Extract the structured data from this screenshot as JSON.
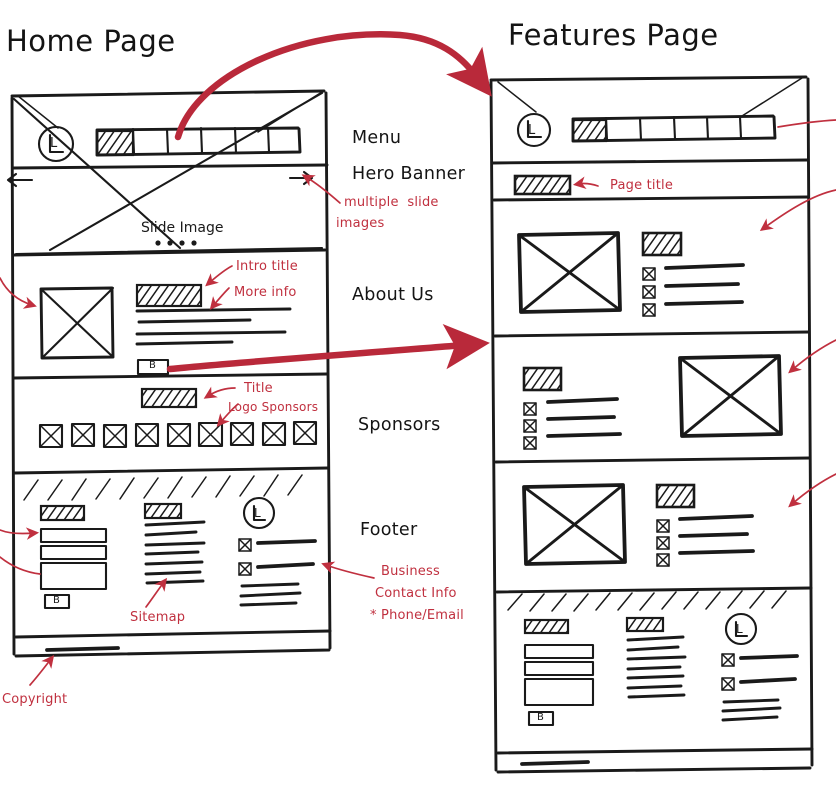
{
  "meta": {
    "kind": "hand-drawn website wireframe sketch",
    "ink_color": "#1a1a1a",
    "annotation_color": "#c0303f"
  },
  "pages": [
    {
      "id": "home",
      "title": "Home Page",
      "sections": [
        {
          "id": "header",
          "label": "Menu",
          "logo": "L",
          "menu_cells": 6,
          "active_cell_index": 0
        },
        {
          "id": "hero",
          "label": "Hero Banner",
          "placeholder_text": "Slide Image",
          "dots": 4,
          "prev_arrow": "←",
          "next_arrow": "→"
        },
        {
          "id": "about",
          "label": "About Us",
          "has_image": true,
          "heading_bar": true,
          "text_lines": 5,
          "button": "B"
        },
        {
          "id": "sponsors",
          "label": "Sponsors",
          "heading_bar": true,
          "logo_count": 9
        },
        {
          "id": "footer",
          "label": "Footer",
          "columns": 3,
          "column_1": {
            "heading_bar": true,
            "fields": 3,
            "button": "B"
          },
          "column_2": {
            "heading_bar": true,
            "link_lines": 7
          },
          "column_3": {
            "logo": "L",
            "contact_items": 2,
            "address_lines": 3
          }
        },
        {
          "id": "copyright",
          "label": "Copyright"
        }
      ],
      "annotations": [
        {
          "id": "multiple-slide-images",
          "text": "multiple slide\nimages"
        },
        {
          "id": "intro-title",
          "text": "Intro title"
        },
        {
          "id": "more-info",
          "text": "More info"
        },
        {
          "id": "sponsors-title",
          "text": "Title"
        },
        {
          "id": "logo-sponsors",
          "text": "Logo Sponsors"
        },
        {
          "id": "sitemap",
          "text": "Sitemap"
        },
        {
          "id": "business-contact",
          "text": "Business\nContact Info\n* Phone/Email"
        },
        {
          "id": "copyright",
          "text": "Copyright"
        }
      ]
    },
    {
      "id": "features",
      "title": "Features Page",
      "sections": [
        {
          "id": "header",
          "logo": "L",
          "menu_cells": 6,
          "active_cell_index": 0
        },
        {
          "id": "page-title-bar",
          "heading_bar": true
        },
        {
          "id": "feature-row-1",
          "image_side": "left",
          "heading_bar": true,
          "bullets": 3
        },
        {
          "id": "feature-row-2",
          "image_side": "right",
          "heading_bar": true,
          "bullets": 3
        },
        {
          "id": "feature-row-3",
          "image_side": "left",
          "heading_bar": true,
          "bullets": 3
        },
        {
          "id": "footer",
          "columns": 3,
          "column_1": {
            "heading_bar": true,
            "fields": 3,
            "button": "B"
          },
          "column_2": {
            "heading_bar": true,
            "link_lines": 7
          },
          "column_3": {
            "logo": "L",
            "contact_items": 2,
            "address_lines": 3
          }
        },
        {
          "id": "copyright"
        }
      ],
      "annotations": [
        {
          "id": "page-title",
          "text": "Page title"
        }
      ]
    }
  ],
  "flow_arrows": [
    {
      "id": "home-menu-to-features",
      "from": "home.menu",
      "to": "features.header"
    },
    {
      "id": "home-about-button-to-features",
      "from": "home.about.button",
      "to": "features.feature-row-2"
    }
  ],
  "labels": {
    "home_title": "Home Page",
    "features_title": "Features Page",
    "menu": "Menu",
    "hero_banner": "Hero Banner",
    "about_us": "About Us",
    "sponsors": "Sponsors",
    "footer": "Footer",
    "slide_image": "Slide Image",
    "logo_letter": "L",
    "button_letter": "B",
    "ann_multiple_slide": "multiple  slide",
    "ann_images": "images",
    "ann_intro_title": "Intro title",
    "ann_more_info": "More info",
    "ann_title": "Title",
    "ann_logo_sponsors": "Logo Sponsors",
    "ann_sitemap": "Sitemap",
    "ann_business": "Business",
    "ann_contact_info": "Contact Info",
    "ann_phone_email": "* Phone/Email",
    "ann_copyright": "Copyright",
    "ann_page_title": "Page title"
  }
}
